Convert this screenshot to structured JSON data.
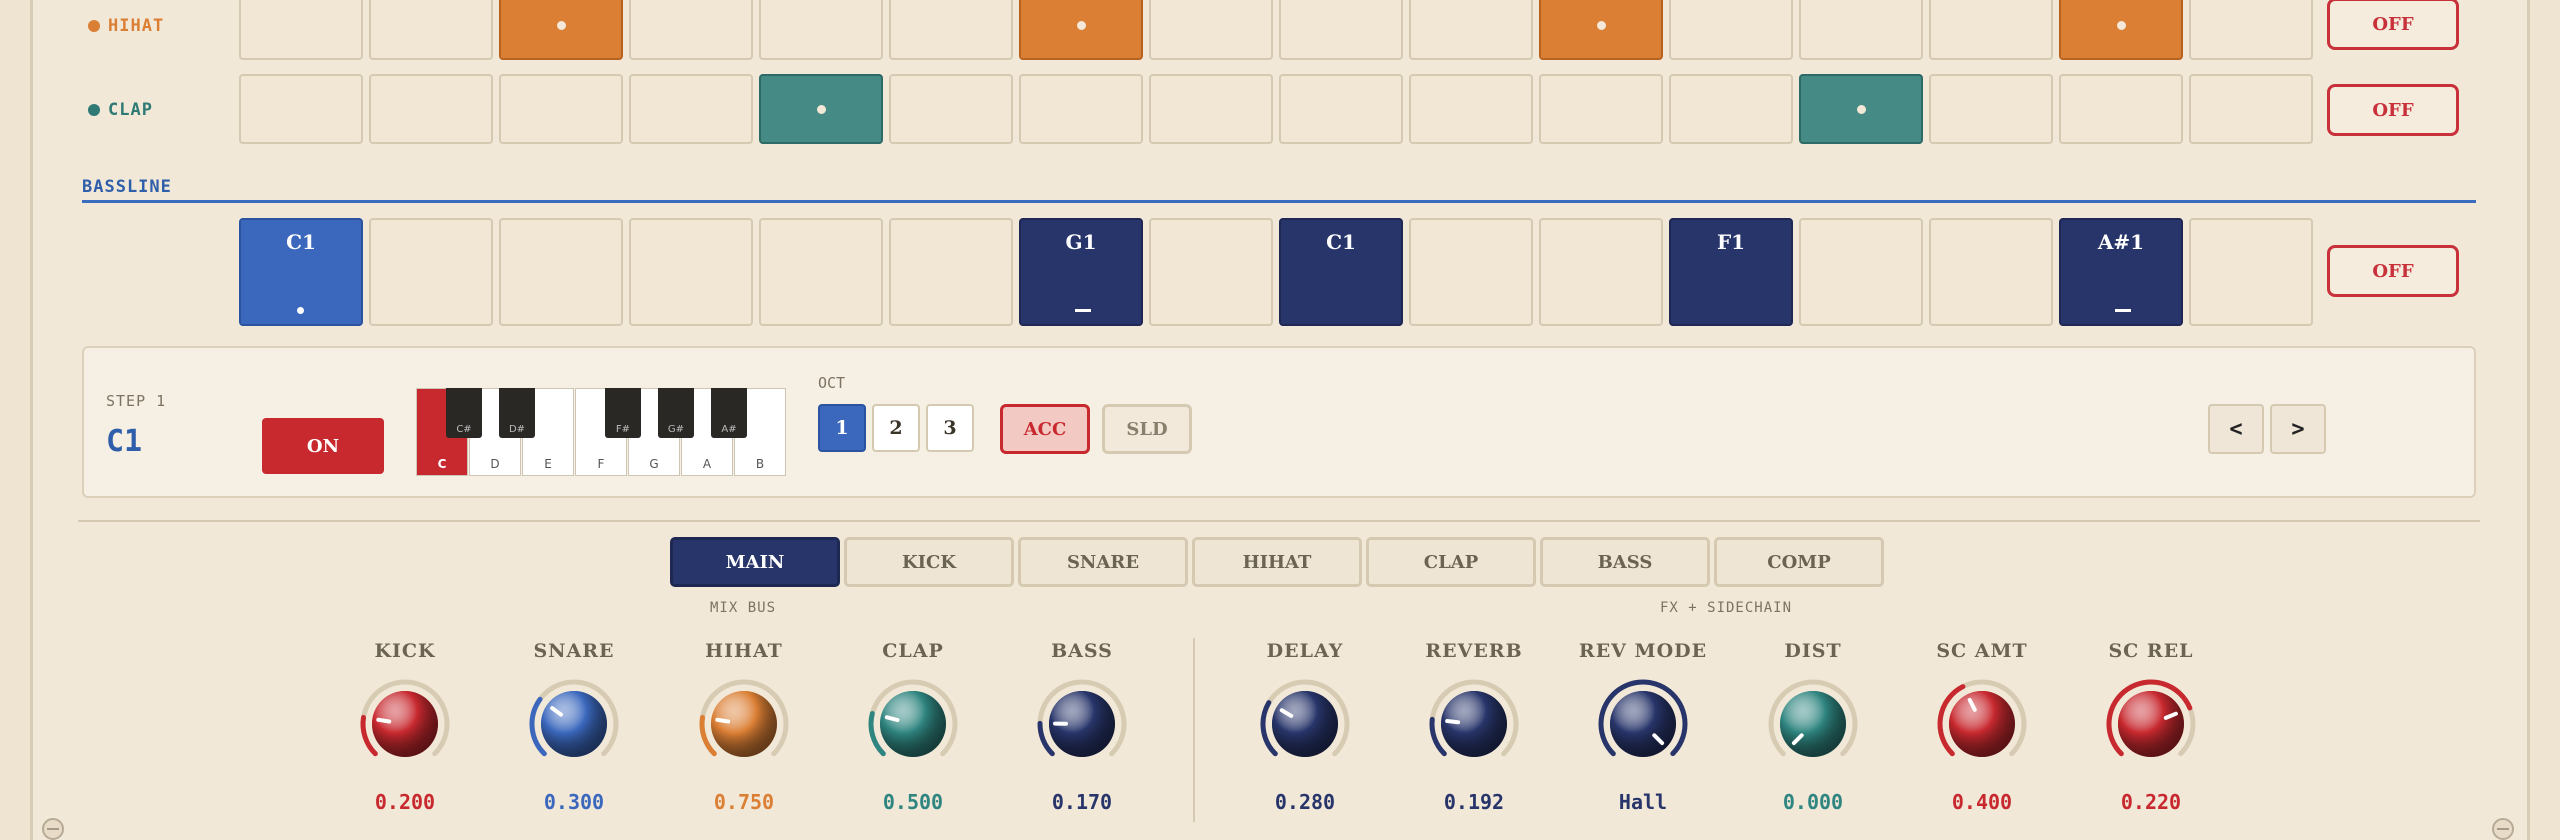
{
  "colors": {
    "hihat": "#db7f35",
    "clap": "#468a85",
    "kick": "#c7292f",
    "snare": "#3b68bd",
    "navy": "#28356a",
    "teal": "#2f8580"
  },
  "tracks": [
    {
      "name": "HIHAT",
      "color": "#db7f35",
      "steps": [
        0,
        0,
        1,
        0,
        0,
        0,
        1,
        0,
        0,
        0,
        1,
        0,
        0,
        0,
        1,
        0
      ],
      "mute_label": "OFF"
    },
    {
      "name": "CLAP",
      "color": "#468a85",
      "steps": [
        0,
        0,
        0,
        0,
        1,
        0,
        0,
        0,
        0,
        0,
        0,
        0,
        1,
        0,
        0,
        0
      ],
      "mute_label": "OFF"
    }
  ],
  "bassline": {
    "title": "BASSLINE",
    "mute_label": "OFF",
    "steps": [
      {
        "note": "C1",
        "state": "active",
        "mark": "dot"
      },
      {
        "note": "",
        "state": "",
        "mark": ""
      },
      {
        "note": "",
        "state": "",
        "mark": ""
      },
      {
        "note": "",
        "state": "",
        "mark": ""
      },
      {
        "note": "",
        "state": "",
        "mark": ""
      },
      {
        "note": "",
        "state": "",
        "mark": ""
      },
      {
        "note": "G1",
        "state": "note",
        "mark": "bar"
      },
      {
        "note": "",
        "state": "",
        "mark": ""
      },
      {
        "note": "C1",
        "state": "note",
        "mark": ""
      },
      {
        "note": "",
        "state": "",
        "mark": ""
      },
      {
        "note": "",
        "state": "",
        "mark": ""
      },
      {
        "note": "F1",
        "state": "note",
        "mark": ""
      },
      {
        "note": "",
        "state": "",
        "mark": ""
      },
      {
        "note": "",
        "state": "",
        "mark": ""
      },
      {
        "note": "A#1",
        "state": "note",
        "mark": "bar"
      },
      {
        "note": "",
        "state": "",
        "mark": ""
      }
    ]
  },
  "editor": {
    "step_label": "STEP 1",
    "step_note": "C1",
    "on_label": "ON",
    "white_keys": [
      "C",
      "D",
      "E",
      "F",
      "G",
      "A",
      "B"
    ],
    "black_keys": [
      "C#",
      "D#",
      "F#",
      "G#",
      "A#"
    ],
    "selected_key": "C",
    "oct_label": "OCT",
    "octaves": [
      "1",
      "2",
      "3"
    ],
    "selected_octave": "1",
    "acc_label": "ACC",
    "sld_label": "SLD",
    "prev_label": "<",
    "next_label": ">"
  },
  "tabs": [
    "MAIN",
    "KICK",
    "SNARE",
    "HIHAT",
    "CLAP",
    "BASS",
    "COMP"
  ],
  "selected_tab": "MAIN",
  "groups": {
    "mix": "MIX BUS",
    "fx": "FX + SIDECHAIN"
  },
  "knobs": [
    {
      "label": "KICK",
      "value": "0.200",
      "level": 0.2,
      "color": "#c7292f",
      "ball": "#c7292f"
    },
    {
      "label": "SNARE",
      "value": "0.300",
      "level": 0.3,
      "color": "#3b68bd",
      "ball": "#3b68bd"
    },
    {
      "label": "HIHAT",
      "value": "0.750",
      "level": 0.2,
      "color": "#db7f35",
      "ball": "#db7f35"
    },
    {
      "label": "CLAP",
      "value": "0.500",
      "level": 0.22,
      "color": "#2f8580",
      "ball": "#2f8580"
    },
    {
      "label": "BASS",
      "value": "0.170",
      "level": 0.17,
      "color": "#28356a",
      "ball": "#28356a"
    },
    {
      "label": "DELAY",
      "value": "0.280",
      "level": 0.28,
      "color": "#28356a",
      "ball": "#28356a"
    },
    {
      "label": "REVERB",
      "value": "0.192",
      "level": 0.19,
      "color": "#28356a",
      "ball": "#28356a"
    },
    {
      "label": "REV MODE",
      "value": "Hall",
      "level": 1.0,
      "color": "#28356a",
      "ball": "#28356a"
    },
    {
      "label": "DIST",
      "value": "0.000",
      "level": 0.0,
      "color": "#2f8580",
      "ball": "#2f8580"
    },
    {
      "label": "SC AMT",
      "value": "0.400",
      "level": 0.4,
      "color": "#c7292f",
      "ball": "#c7292f"
    },
    {
      "label": "SC REL",
      "value": "0.220",
      "level": 0.75,
      "color": "#c7292f",
      "ball": "#c7292f"
    }
  ]
}
